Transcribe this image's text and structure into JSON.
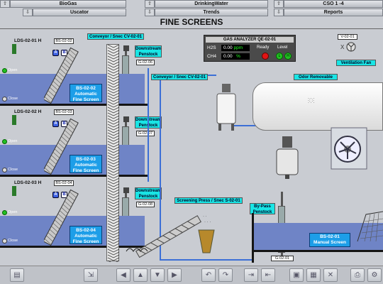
{
  "nav": {
    "row1": [
      "BioGas",
      "DrinkingWater",
      "CSO 1 -4"
    ],
    "row2": [
      "Uscator",
      "Trends",
      "Reports"
    ]
  },
  "page_title": "FINE SCREENS",
  "conveyor_top": "Conveyor / Snec CV-02-01",
  "conveyor_mid": "Conveyor / Snec CV-02-01",
  "screening_press": "Screening Press / Snec S-02-01",
  "gas": {
    "title": "GAS ANALYZER QE-02-01",
    "h2s_label": "H2S",
    "h2s_value": "0.00",
    "h2s_unit": "ppm",
    "ch4_label": "CH4",
    "ch4_value": "0.00",
    "ch4_unit": "%",
    "ready": "Ready",
    "level": "Level"
  },
  "vent": {
    "tag": "V-02-01",
    "label": "Ventilation Fan"
  },
  "odor": "Odor Removable",
  "screens": [
    {
      "lds": "LDS-02-01 H",
      "tag": "BS-02-02",
      "name": "BS-02-02\nAutomatic\nFine Screen",
      "open": "Open",
      "close": "Close",
      "pen_label": "Downstream\nPenstock",
      "pen_tag": "G-02-06"
    },
    {
      "lds": "LDS-02-02 H",
      "tag": "BS-02-03",
      "name": "BS-02-03\nAutomatic\nFine Screen",
      "open": "Open",
      "close": "Close",
      "pen_label": "Downstream\nPenstock",
      "pen_tag": "G-02-07"
    },
    {
      "lds": "LDS-02-03 H",
      "tag": "BS-02-04",
      "name": "BS-02-04\nAutomatic\nFine Screen",
      "open": "Open",
      "close": "Close",
      "pen_label": "Downstream\nPenstock",
      "pen_tag": "G-02-08"
    }
  ],
  "bypass": {
    "label": "By-Pass\nPenstock",
    "tag": "G-02-01"
  },
  "manual": "BS-02-01\nManual Screen",
  "ab": {
    "a": "A",
    "b": "B"
  },
  "colors": {
    "water": "#6f84c6",
    "pipe": "#3c6fd6",
    "cyan": "#19e5e5",
    "block": "#1d9ee8",
    "green": "#22c122",
    "red": "#e11515"
  }
}
